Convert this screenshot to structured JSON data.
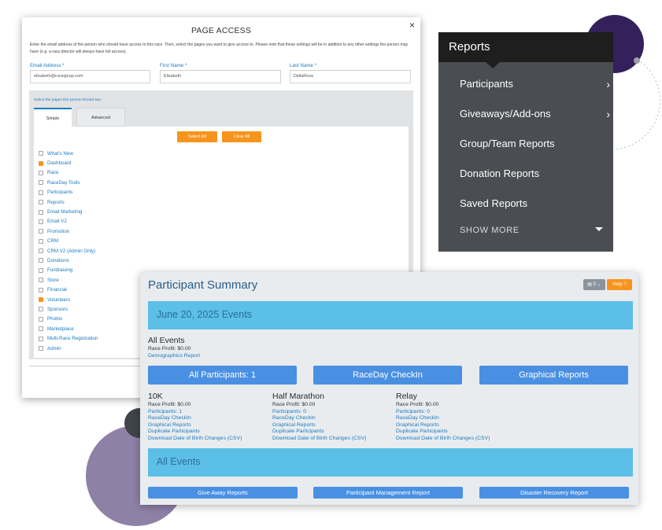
{
  "access": {
    "title": "PAGE ACCESS",
    "close": "×",
    "intro": "Enter the email address of the person who should have access to this race. Then, select the pages you want to give access to. Please note that these settings will be in addition to any other settings the person may have (e.g. a race director will always have full access).",
    "email_label": "Email Address *",
    "email_value": "elisabeth@runsignup.com",
    "first_label": "First Name *",
    "first_value": "Elisabeth",
    "last_label": "Last Name *",
    "last_value": "DellaRoxa",
    "select_label": "Select the pages this person should see.",
    "tabs": [
      "Simple",
      "Advanced"
    ],
    "select_all": "Select All",
    "clear_all": "Clear All",
    "pages": [
      {
        "label": "What's New",
        "checked": false
      },
      {
        "label": "Dashboard",
        "checked": true
      },
      {
        "label": "Race",
        "checked": false
      },
      {
        "label": "RaceDay Tools",
        "checked": false
      },
      {
        "label": "Participants",
        "checked": false
      },
      {
        "label": "Reports",
        "checked": false
      },
      {
        "label": "Email Marketing",
        "checked": false
      },
      {
        "label": "Email V2",
        "checked": false
      },
      {
        "label": "Promotion",
        "checked": false
      },
      {
        "label": "CRM",
        "checked": false
      },
      {
        "label": "CRM V2 (Admin Only)",
        "checked": false
      },
      {
        "label": "Donations",
        "checked": false
      },
      {
        "label": "Fundraising",
        "checked": false
      },
      {
        "label": "Store",
        "checked": false
      },
      {
        "label": "Financial",
        "checked": false
      },
      {
        "label": "Volunteers",
        "checked": true
      },
      {
        "label": "Sponsors",
        "checked": false
      },
      {
        "label": "Photos",
        "checked": false
      },
      {
        "label": "Marketplace",
        "checked": false
      },
      {
        "label": "Multi-Race Registration",
        "checked": false
      },
      {
        "label": "Admin",
        "checked": false
      }
    ]
  },
  "reports_menu": {
    "title": "Reports",
    "items": [
      "Participants",
      "Giveaways/Add-ons",
      "Group/Team Reports",
      "Donation Reports",
      "Saved Reports"
    ],
    "show_more": "SHOW  MORE"
  },
  "summary": {
    "title": "Participant Summary",
    "dropdown": "0",
    "help": "Help",
    "date_band": "June 20, 2025 Events",
    "all_events_heading": "All Events",
    "all_events_profit": "Race Profit: $0.00",
    "demographics": "Demographics Report",
    "buttons": [
      "All Participants: 1",
      "RaceDay CheckIn",
      "Graphical Reports"
    ],
    "events": [
      {
        "name": "10K",
        "profit": "Race Profit: $0.00",
        "participants": "Participants: 1"
      },
      {
        "name": "Half Marathon",
        "profit": "Race Profit: $0.00",
        "participants": "Participants: 0"
      },
      {
        "name": "Relay",
        "profit": "Race Profit: $0.00",
        "participants": "Participants: 0"
      }
    ],
    "event_links": [
      "RaceDay CheckIn",
      "Graphical Reports",
      "Duplicate Participants",
      "Download Date of Birth Changes (CSV)"
    ],
    "all_events_band": "All Events",
    "bottom_buttons": [
      "Give Away Reports",
      "Participant Management Report",
      "Disaster Recovery Report"
    ]
  },
  "colors": {
    "accent_orange": "#f7941d",
    "accent_blue": "#4a90e2",
    "band_blue": "#5bbfe7",
    "menu_bg": "#4a4d52"
  }
}
